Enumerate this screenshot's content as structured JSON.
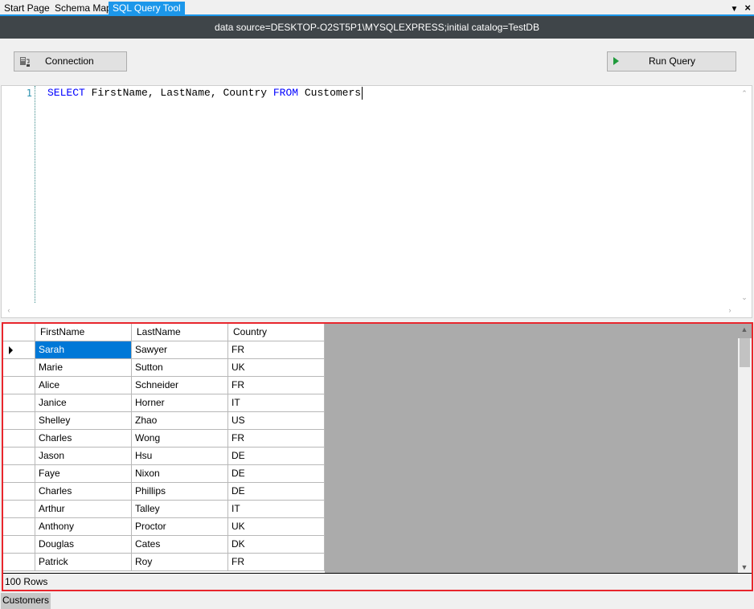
{
  "tabs": {
    "start_page": "Start Page",
    "schema_map": "Schema Map",
    "sql_query_tool": "SQL Query Tool"
  },
  "connection_banner": "data source=DESKTOP-O2ST5P1\\MYSQLEXPRESS;initial catalog=TestDB",
  "toolbar": {
    "connection_label": "Connection",
    "run_query_label": "Run Query"
  },
  "editor": {
    "line_number": "1",
    "query_tokens": [
      {
        "text": "SELECT",
        "kind": "keyword"
      },
      {
        "text": " FirstName, LastName, Country ",
        "kind": "text"
      },
      {
        "text": "FROM",
        "kind": "keyword"
      },
      {
        "text": " Customers",
        "kind": "text"
      }
    ]
  },
  "results": {
    "columns": [
      "FirstName",
      "LastName",
      "Country"
    ],
    "rows": [
      [
        "Sarah",
        "Sawyer",
        "FR"
      ],
      [
        "Marie",
        "Sutton",
        "UK"
      ],
      [
        "Alice",
        "Schneider",
        "FR"
      ],
      [
        "Janice",
        "Horner",
        "IT"
      ],
      [
        "Shelley",
        "Zhao",
        "US"
      ],
      [
        "Charles",
        "Wong",
        "FR"
      ],
      [
        "Jason",
        "Hsu",
        "DE"
      ],
      [
        "Faye",
        "Nixon",
        "DE"
      ],
      [
        "Charles",
        "Phillips",
        "DE"
      ],
      [
        "Arthur",
        "Talley",
        "IT"
      ],
      [
        "Anthony",
        "Proctor",
        "UK"
      ],
      [
        "Douglas",
        "Cates",
        "DK"
      ],
      [
        "Patrick",
        "Roy",
        "FR"
      ]
    ],
    "row_count_label": "100 Rows"
  },
  "bottom_tab": "Customers",
  "colors": {
    "accent": "#1c97ea",
    "banner_bg": "#3f4549",
    "selection": "#0078d7",
    "keyword": "#0000ff",
    "results_outline": "#e8262d"
  }
}
